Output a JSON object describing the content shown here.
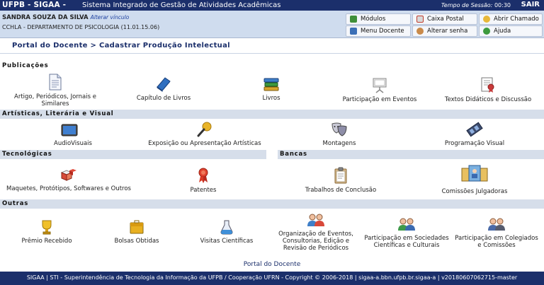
{
  "topbar": {
    "brand": "UFPB - SIGAA -",
    "system": "Sistema Integrado de Gestão de Atividades Acadêmicas",
    "session_label": "Tempo de Sessão:",
    "session_time": "00:30",
    "exit_label": "SAIR"
  },
  "user": {
    "name": "SANDRA SOUZA DA SILVA",
    "change_link": "Alterar vínculo",
    "department": "CCHLA - DEPARTAMENTO DE PSICOLOGIA (11.01.15.06)"
  },
  "quick_buttons": {
    "modulos": "Módulos",
    "caixa_postal": "Caixa Postal",
    "abrir_chamado": "Abrir Chamado",
    "menu_docente": "Menu Docente",
    "alterar_senha": "Alterar senha",
    "ajuda": "Ajuda"
  },
  "breadcrumb": "Portal do Docente > Cadastrar Produção Intelectual",
  "sections": {
    "publicacoes": "Publicações",
    "artisticas": "Artísticas, Literária e Visual",
    "tecnologicas": "Tecnológicas",
    "bancas": "Bancas",
    "outras": "Outras"
  },
  "publicacoes": {
    "artigo": [
      "Artigo, Periódicos, Jornais e",
      "Similares"
    ],
    "capitulo": "Capítulo de Livros",
    "livros": "Livros",
    "eventos": "Participação em Eventos",
    "textos": "Textos Didáticos e Discussão"
  },
  "artisticas": {
    "audiovisuais": "AudioVisuais",
    "exposicao": "Exposição ou Apresentação Artísticas",
    "montagens": "Montagens",
    "programacao": "Programação Visual"
  },
  "tecnologicas": {
    "maquetes": "Maquetes, Protótipos, Softwares e Outros",
    "patentes": "Patentes"
  },
  "bancas": {
    "trabalhos": "Trabalhos de Conclusão",
    "comissoes": "Comissões Julgadoras"
  },
  "outras": {
    "premio": "Prêmio Recebido",
    "bolsas": "Bolsas Obtidas",
    "visitas": "Visitas Científicas",
    "organizacao": [
      "Organização de Eventos,",
      "Consultorias, Edição e",
      "Revisão de Periódicos"
    ],
    "sociedades": [
      "Participação em Sociedades",
      "Científicas e Culturais"
    ],
    "colegiados": [
      "Participação em Colegiados",
      "e Comissões"
    ]
  },
  "footer": {
    "portal_link": "Portal do Docente",
    "copyright": "SIGAA | STI - Superintendência de Tecnologia da Informação da UFPB / Cooperação UFRN - Copyright © 2006-2018 | sigaa-a.bbn.ufpb.br.sigaa-a | v20180607062715-master"
  },
  "colors": {
    "topbar": "#1b2f6b",
    "userbar": "#cfdcee",
    "section": "#d6deea",
    "link": "#1b3fa0"
  }
}
